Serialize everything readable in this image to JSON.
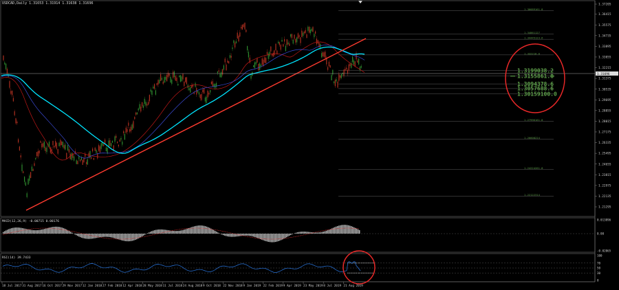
{
  "chart_header": {
    "symbol": "USDCAD,Daily",
    "ohlc": "1.31653 1.31914 1.31638 1.31696"
  },
  "price_axis": {
    "ticks": [
      "1.37205",
      "1.36415",
      "1.35575",
      "1.34735",
      "1.33895",
      "1.33055",
      "1.32215",
      "1.31375",
      "1.30535",
      "1.29695",
      "1.28855",
      "1.28015",
      "1.27175",
      "1.26335",
      "1.25495",
      "1.24655",
      "1.23815",
      "1.22975",
      "1.22135",
      "1.21295"
    ],
    "current_price": "1.31696"
  },
  "fib_levels": [
    {
      "value": "1.36689",
      "pct": "161.8"
    },
    {
      "value": "1.34861",
      "pct": "127"
    },
    {
      "value": "1.34445",
      "pct": "123.6"
    },
    {
      "value": "1.33221",
      "pct": "0.0"
    },
    {
      "value": "1.31990",
      "pct": "38.2"
    },
    {
      "value": "1.31558",
      "pct": "61.8"
    },
    {
      "value": "1.30943",
      "pct": "78.6"
    },
    {
      "value": "1.30576",
      "pct": "88.6"
    },
    {
      "value": "1.30159",
      "pct": "100.0"
    },
    {
      "value": "1.27996",
      "pct": "161.8"
    },
    {
      "value": "1.26608",
      "pct": "224"
    },
    {
      "value": "1.24224",
      "pct": "261.8"
    },
    {
      "value": "1.22122",
      "pct": "314"
    }
  ],
  "macd": {
    "label": "MACD(12,26,9) -0.00715 0.00176",
    "ticks": [
      "0.013896",
      "0.00",
      "-0.02065"
    ]
  },
  "rsi": {
    "label": "RSI(14) 39.7433",
    "ticks": [
      "100",
      "70",
      "50",
      "30",
      "0"
    ]
  },
  "time_axis": [
    "18 Jul 2017",
    "31 Aug 2017",
    "16 Oct 2017",
    "29 Nov 2017",
    "12 Jan 2018",
    "27 Feb 2018",
    "12 Apr 2018",
    "28 May 2018",
    "11 Jul 2018",
    "24 Aug 2018",
    "9 Oct 2018",
    "22 Nov 2018",
    "9 Jan 2019",
    "22 Feb 2019",
    "9 Apr 2019",
    "23 May 2019",
    "8 Jul 2019",
    "21 Aug 2019"
  ],
  "colors": {
    "trendline": "#ff3b2f",
    "ma_fast": "#00e5ff",
    "ma_mid": "#3b4bd6",
    "ma_slow": "#c01818",
    "bull": "#2e8b2e",
    "bear": "#b03020",
    "highlight": "#e82828",
    "rsi_line": "#2a78e4"
  }
}
